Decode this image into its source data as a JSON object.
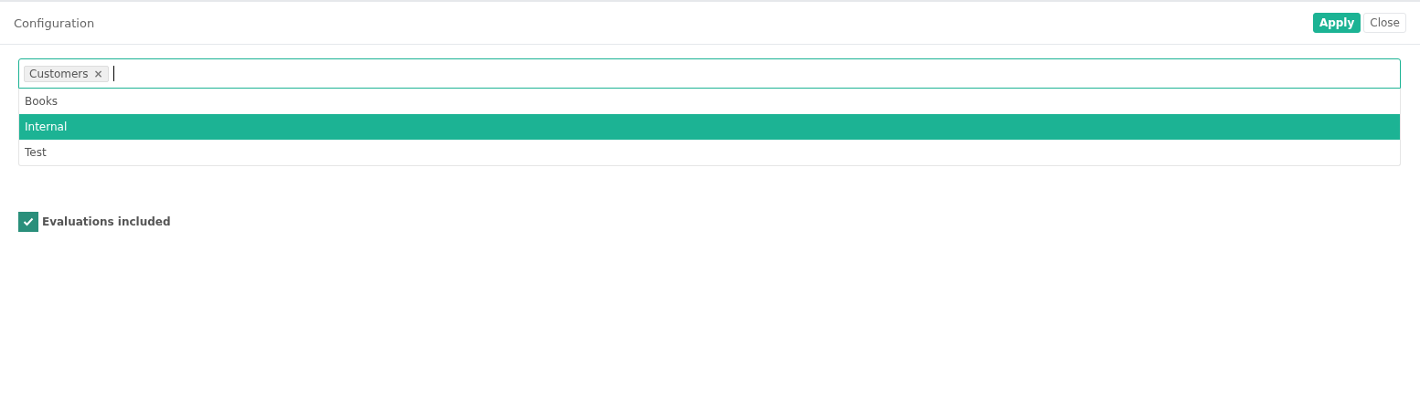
{
  "header": {
    "title": "Configuration",
    "buttons": [
      {
        "label": "Apply",
        "kind": "primary"
      },
      {
        "label": "Close",
        "kind": "default"
      }
    ]
  },
  "select": {
    "tags": [
      {
        "label": "Customers",
        "remove": "×"
      }
    ],
    "focused": true,
    "options": [
      {
        "label": "Books",
        "selected": false
      },
      {
        "label": "Internal",
        "selected": true
      },
      {
        "label": "Test",
        "selected": false
      }
    ]
  },
  "checkbox": {
    "label": "Evaluations included",
    "checked": true
  }
}
